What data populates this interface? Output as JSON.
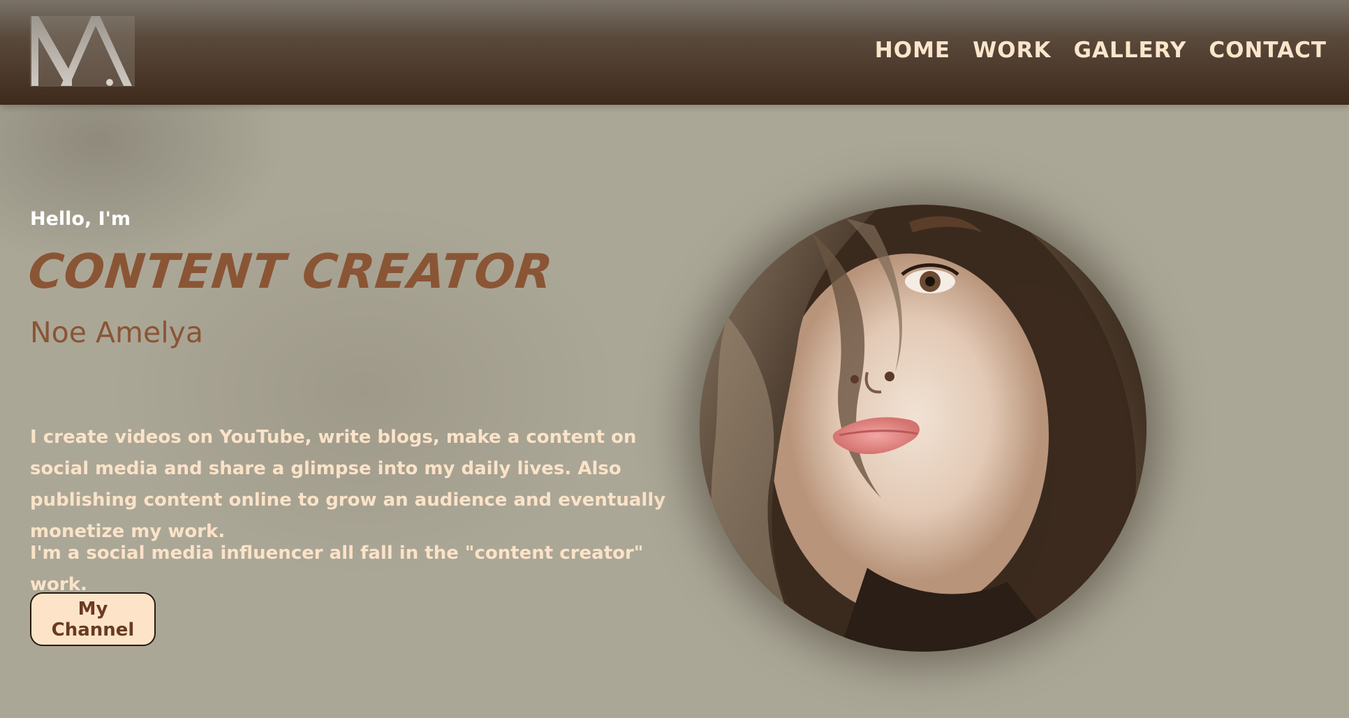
{
  "brand": {
    "logo_text": "NA.",
    "logo_icon": "monogram-logo"
  },
  "nav": {
    "items": [
      {
        "label": "HOME"
      },
      {
        "label": "WORK"
      },
      {
        "label": "GALLERY"
      },
      {
        "label": "CONTACT"
      }
    ]
  },
  "hero": {
    "greeting": "Hello, I'm",
    "headline": "CONTENT CREATOR",
    "name": "Noe Amelya",
    "paragraph_1": "I create videos on YouTube, write blogs, make a content on social media and share a glimpse into my daily lives. Also publishing content online to grow an audience and eventually monetize my work.",
    "paragraph_2": "I'm a social media influencer all fall in the \"content creator\" work.",
    "button_label": "My Channel"
  },
  "portrait": {
    "icon": "profile-portrait-image"
  },
  "colors": {
    "header_dark": "#3f2a1c",
    "background": "#aba797",
    "accent_brown": "#8a5535",
    "cream_text": "#fbe3c8",
    "button_bg": "#fde4c8"
  }
}
